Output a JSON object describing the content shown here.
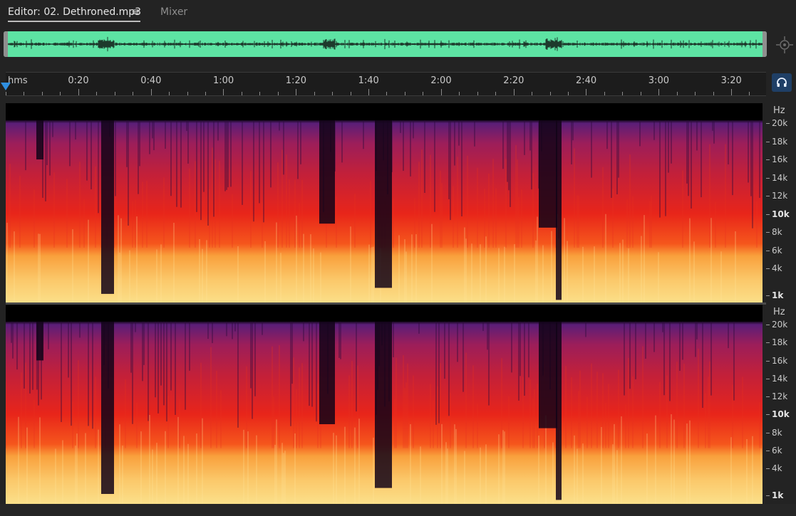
{
  "tabs": {
    "editor_label": "Editor: 02. Dethroned.mp3",
    "menu_icon": "≡",
    "mixer_label": "Mixer"
  },
  "timeline": {
    "unit_label": "hms",
    "ticks": [
      "0:20",
      "0:40",
      "1:00",
      "1:20",
      "1:40",
      "2:00",
      "2:20",
      "2:40",
      "3:00",
      "3:20"
    ]
  },
  "frequency_axis": {
    "unit": "Hz",
    "labels": [
      {
        "text": "20k",
        "bold": false
      },
      {
        "text": "18k",
        "bold": false
      },
      {
        "text": "16k",
        "bold": false
      },
      {
        "text": "14k",
        "bold": false
      },
      {
        "text": "12k",
        "bold": false
      },
      {
        "text": "10k",
        "bold": true
      },
      {
        "text": "8k",
        "bold": false
      },
      {
        "text": "6k",
        "bold": false
      },
      {
        "text": "4k",
        "bold": false
      },
      {
        "text": "1k",
        "bold": true
      }
    ]
  },
  "colors": {
    "overview_waveform": "#5de3a3",
    "playhead": "#2f8fe0",
    "spectrum_high": "#fbe08a",
    "spectrum_mid": "#e8251a",
    "spectrum_low": "#5a1e78"
  },
  "icons": {
    "zoom_navigator": "crosshair-zoom-icon",
    "monitor": "headphones-icon"
  }
}
